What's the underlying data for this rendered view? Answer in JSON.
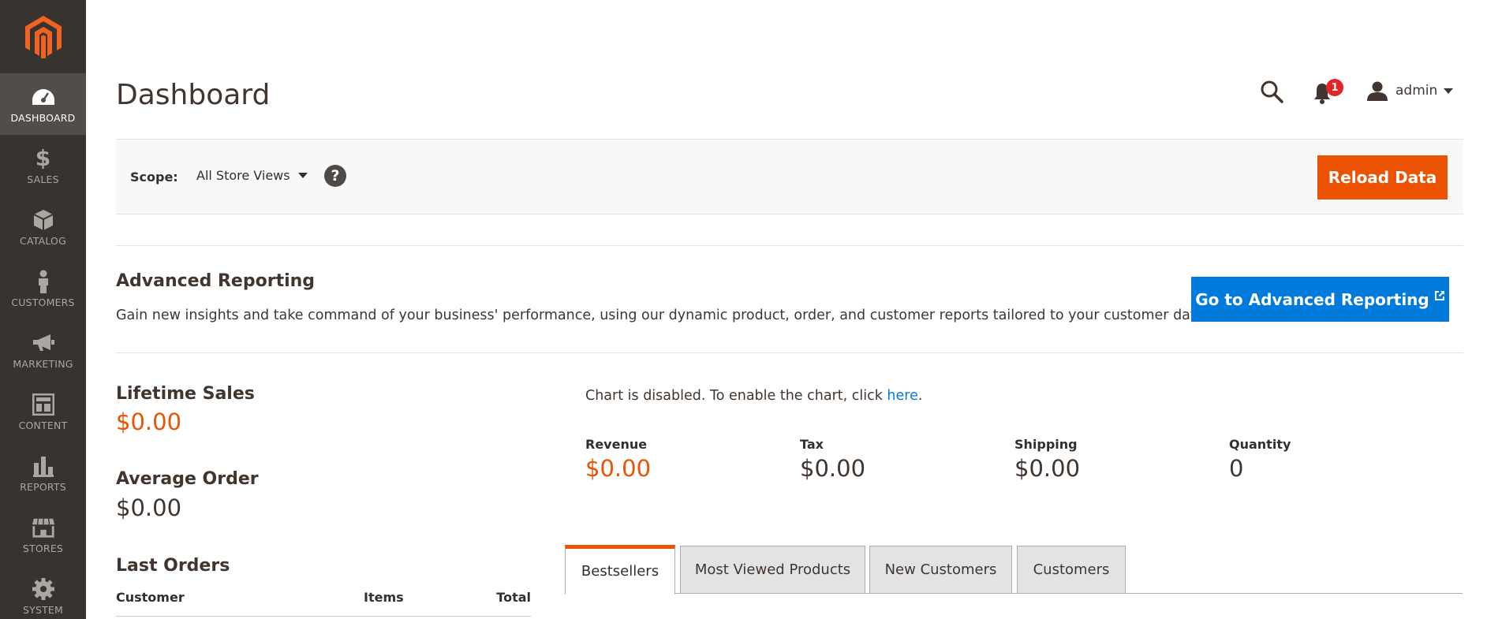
{
  "sidebar": {
    "items": [
      {
        "label": "DASHBOARD",
        "icon": "dashboard-icon",
        "active": true
      },
      {
        "label": "SALES",
        "icon": "dollar-icon"
      },
      {
        "label": "CATALOG",
        "icon": "box-icon"
      },
      {
        "label": "CUSTOMERS",
        "icon": "person-icon"
      },
      {
        "label": "MARKETING",
        "icon": "megaphone-icon"
      },
      {
        "label": "CONTENT",
        "icon": "layout-icon"
      },
      {
        "label": "REPORTS",
        "icon": "bar-chart-icon"
      },
      {
        "label": "STORES",
        "icon": "storefront-icon"
      },
      {
        "label": "SYSTEM",
        "icon": "gear-icon"
      }
    ]
  },
  "header": {
    "title": "Dashboard",
    "notifications_count": "1",
    "user_name": "admin"
  },
  "scope": {
    "label": "Scope:",
    "selected": "All Store Views",
    "help": "?",
    "reload_label": "Reload Data"
  },
  "advanced_reporting": {
    "title": "Advanced Reporting",
    "description": "Gain new insights and take command of your business' performance, using our dynamic product, order, and customer reports tailored to your customer data.",
    "button_label": "Go to Advanced Reporting"
  },
  "stats": {
    "lifetime_sales_label": "Lifetime Sales",
    "lifetime_sales_value": "$0.00",
    "average_order_label": "Average Order",
    "average_order_value": "$0.00"
  },
  "last_orders": {
    "title": "Last Orders",
    "columns": [
      "Customer",
      "Items",
      "Total"
    ]
  },
  "chart": {
    "message_prefix": "Chart is disabled. To enable the chart, click ",
    "link_text": "here",
    "message_suffix": "."
  },
  "totals": [
    {
      "label": "Revenue",
      "value": "$0.00"
    },
    {
      "label": "Tax",
      "value": "$0.00"
    },
    {
      "label": "Shipping",
      "value": "$0.00"
    },
    {
      "label": "Quantity",
      "value": "0"
    }
  ],
  "tabs": [
    {
      "label": "Bestsellers",
      "active": true
    },
    {
      "label": "Most Viewed Products"
    },
    {
      "label": "New Customers"
    },
    {
      "label": "Customers"
    }
  ],
  "colors": {
    "sidebar_bg": "#373330",
    "accent_orange": "#eb5202",
    "link_blue": "#007bdb",
    "badge_red": "#e22626"
  }
}
